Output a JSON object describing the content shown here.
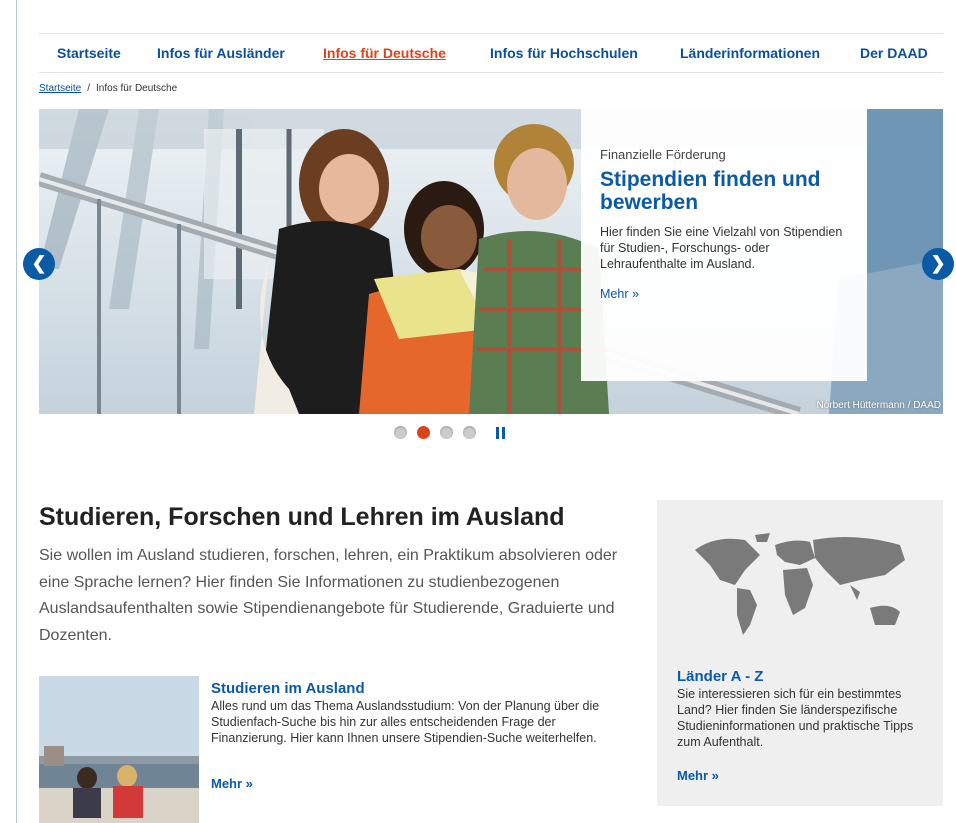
{
  "nav": {
    "items": [
      {
        "label": "Startseite"
      },
      {
        "label": "Infos für Ausländer"
      },
      {
        "label": "Infos für Deutsche"
      },
      {
        "label": "Infos für Hochschulen"
      },
      {
        "label": "Länderinformationen"
      },
      {
        "label": "Der DAAD"
      }
    ],
    "active_index": 2
  },
  "breadcrumb": {
    "home": "Startseite",
    "separator": "/",
    "current": "Infos für Deutsche"
  },
  "slider": {
    "kicker": "Finanzielle Förderung",
    "title": "Stipendien finden und bewerben",
    "text": "Hier finden Sie eine Vielzahl von Stipendien für Studien-, Forschungs- oder Lehraufenthalte im Ausland.",
    "more": "Mehr »",
    "credit": "Norbert Hüttermann / DAAD",
    "prev_symbol": "❮",
    "next_symbol": "❯",
    "slide_count": 4,
    "active_slide": 2,
    "pause_icon": "pause-icon"
  },
  "main": {
    "title": "Studieren, Forschen und Lehren im Ausland",
    "intro": "Sie wollen im Ausland studieren, forschen, lehren, ein Praktikum absolvieren oder eine Sprache lernen? Hier finden Sie Informationen zu studienbezogenen Auslandsaufenthalten sowie Stipendienangebote für Studierende, Graduierte und Dozenten.",
    "teaser": {
      "title": "Studieren im Ausland",
      "text": "Alles rund um das Thema Auslandsstudium: Von der Planung über die Studienfach-Suche bis hin zur alles entscheidenden Frage der Finanzierung. Hier kann Ihnen unsere Stipendien-Suche weiterhelfen.",
      "more": "Mehr »"
    }
  },
  "sidebox": {
    "title": "Länder A - Z",
    "text": "Sie interessieren sich für ein bestimmtes Land? Hier finden Sie länderspezifische Studieninformationen und praktische Tipps zum Aufenthalt.",
    "more": "Mehr »"
  },
  "colors": {
    "link_blue": "#0a5aa6",
    "nav_blue": "#0a4f9a",
    "active_orange": "#d9441b"
  }
}
